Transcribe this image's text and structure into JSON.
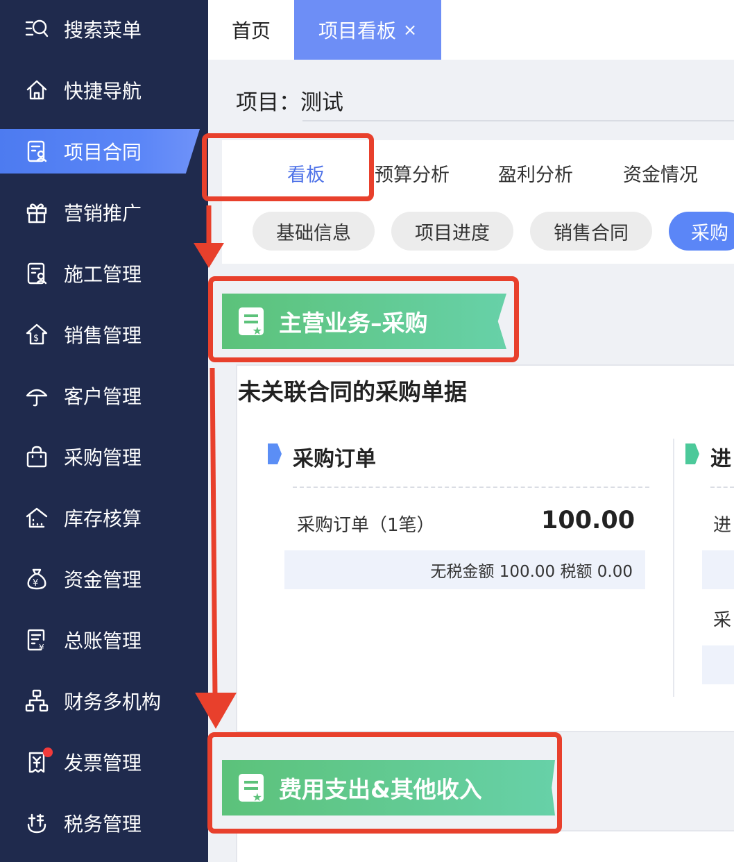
{
  "sidebar": {
    "items": [
      {
        "label": "搜索菜单",
        "icon": "search-menu-icon"
      },
      {
        "label": "快捷导航",
        "icon": "home-icon"
      },
      {
        "label": "项目合同",
        "icon": "contract-icon"
      },
      {
        "label": "营销推广",
        "icon": "gift-icon"
      },
      {
        "label": "施工管理",
        "icon": "construction-doc-icon"
      },
      {
        "label": "销售管理",
        "icon": "sales-icon"
      },
      {
        "label": "客户管理",
        "icon": "umbrella-icon"
      },
      {
        "label": "采购管理",
        "icon": "shopping-bag-icon"
      },
      {
        "label": "库存核算",
        "icon": "warehouse-icon"
      },
      {
        "label": "资金管理",
        "icon": "money-bag-icon"
      },
      {
        "label": "总账管理",
        "icon": "ledger-icon"
      },
      {
        "label": "财务多机构",
        "icon": "org-chart-icon"
      },
      {
        "label": "发票管理",
        "icon": "invoice-icon"
      },
      {
        "label": "税务管理",
        "icon": "tax-icon"
      }
    ],
    "active_index": 2
  },
  "tabs": {
    "home": "首页",
    "active": "项目看板",
    "close_glyph": "×"
  },
  "project": {
    "label": "项目：",
    "name": "测试"
  },
  "subtabs": [
    "看板",
    "预算分析",
    "盈利分析",
    "资金情况"
  ],
  "pills": [
    "基础信息",
    "项目进度",
    "销售合同",
    "采购"
  ],
  "section1": {
    "banner": "主营业务–采购",
    "card_title": "未关联合同的采购单据",
    "col1": {
      "title": "采购订单",
      "row_label": "采购订单（1笔）",
      "amount": "100.00",
      "sub_text": "无税金额 100.00 税额 0.00"
    },
    "col2": {
      "title": "进",
      "row_label": "进",
      "row2_label": "采"
    }
  },
  "section2": {
    "banner": "费用支出&其他收入"
  },
  "colors": {
    "sidebar_bg": "#1f2a4d",
    "accent": "#5b86f7",
    "banner_green": "#5cc27a",
    "annotation_red": "#e8402c"
  }
}
